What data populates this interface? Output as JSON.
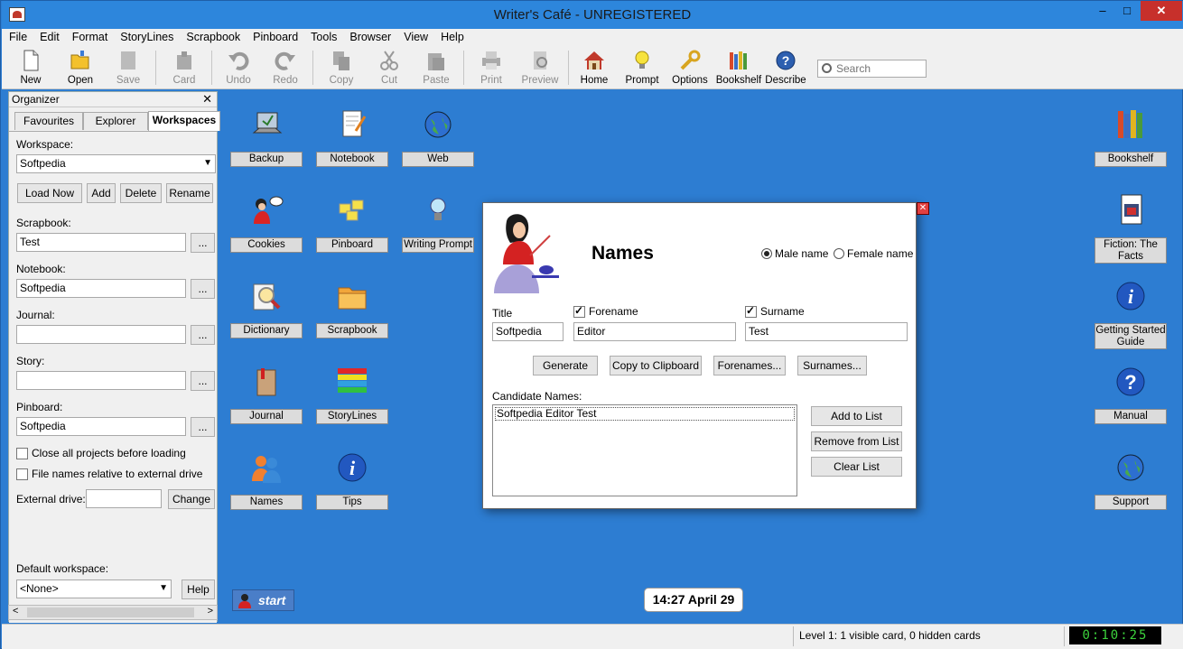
{
  "window": {
    "title": "Writer's Café - UNREGISTERED",
    "minimize": "‒",
    "maximize": "□",
    "close": "✕"
  },
  "menu": [
    "File",
    "Edit",
    "Format",
    "StoryLines",
    "Scrapbook",
    "Pinboard",
    "Tools",
    "Browser",
    "View",
    "Help"
  ],
  "toolbar": {
    "new": "New",
    "open": "Open",
    "save": "Save",
    "card": "Card",
    "undo": "Undo",
    "redo": "Redo",
    "copy": "Copy",
    "cut": "Cut",
    "paste": "Paste",
    "print": "Print",
    "preview": "Preview",
    "home": "Home",
    "prompt": "Prompt",
    "options": "Options",
    "bookshelf": "Bookshelf",
    "describe": "Describe",
    "search_placeholder": "Search"
  },
  "organizer": {
    "title": "Organizer",
    "close": "✕",
    "tabs": [
      "Favourites",
      "Explorer",
      "Workspaces"
    ],
    "workspace_label": "Workspace:",
    "workspace_value": "Softpedia",
    "load_now": "Load Now",
    "add": "Add",
    "delete": "Delete",
    "rename": "Rename",
    "scrapbook_label": "Scrapbook:",
    "scrapbook_value": "Test",
    "notebook_label": "Notebook:",
    "notebook_value": "Softpedia",
    "journal_label": "Journal:",
    "journal_value": "",
    "story_label": "Story:",
    "story_value": "",
    "pinboard_label": "Pinboard:",
    "pinboard_value": "Softpedia",
    "browse": "...",
    "close_all": "Close all projects before loading",
    "relative": "File names relative to external drive",
    "external_label": "External drive:",
    "external_value": "",
    "change": "Change",
    "default_label": "Default workspace:",
    "default_value": "<None>",
    "help": "Help"
  },
  "desktop": {
    "backup": "Backup",
    "notebook": "Notebook",
    "web": "Web",
    "cookies": "Cookies",
    "pinboard": "Pinboard",
    "writing_prompt": "Writing Prompt",
    "dictionary": "Dictionary",
    "scrapbook": "Scrapbook",
    "journal": "Journal",
    "storylines": "StoryLines",
    "names": "Names",
    "tips": "Tips",
    "bookshelf": "Bookshelf",
    "fiction": "Fiction: The Facts",
    "getting_started": "Getting Started Guide",
    "manual": "Manual",
    "support": "Support",
    "start": "start",
    "clock": "14:27 April 29"
  },
  "dialog": {
    "title": "Names",
    "close": "✕",
    "male": "Male name",
    "female": "Female name",
    "title_label": "Title",
    "title_value": "Softpedia",
    "forename_label": "Forename",
    "forename_value": "Editor",
    "surname_label": "Surname",
    "surname_value": "Test",
    "generate": "Generate",
    "copy_clip": "Copy to Clipboard",
    "forenames": "Forenames...",
    "surnames": "Surnames...",
    "candidates_label": "Candidate Names:",
    "candidates": [
      "Softpedia Editor Test"
    ],
    "add_list": "Add to List",
    "remove_list": "Remove from List",
    "clear_list": "Clear List"
  },
  "status": {
    "text": "Level 1: 1 visible card, 0 hidden cards",
    "timer": "0:10:25"
  }
}
